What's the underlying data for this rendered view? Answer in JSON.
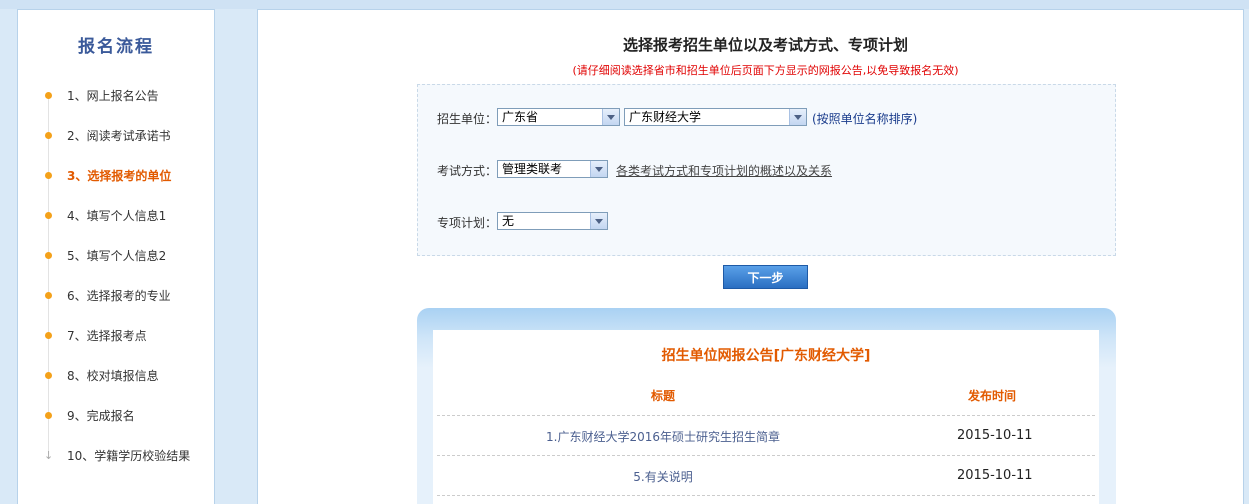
{
  "sidebar": {
    "title": "报名流程",
    "steps": [
      {
        "label": "1、网上报名公告"
      },
      {
        "label": "2、阅读考试承诺书"
      },
      {
        "label": "3、选择报考的单位"
      },
      {
        "label": "4、填写个人信息1"
      },
      {
        "label": "5、填写个人信息2"
      },
      {
        "label": "6、选择报考的专业"
      },
      {
        "label": "7、选择报考点"
      },
      {
        "label": "8、校对填报信息"
      },
      {
        "label": "9、完成报名"
      },
      {
        "label": "10、学籍学历校验结果"
      }
    ],
    "active_step": 3
  },
  "main": {
    "title": "选择报考招生单位以及考试方式、专项计划",
    "warning": "(请仔细阅读选择省市和招生单位后页面下方显示的网报公告,以免导致报名无效)",
    "form": {
      "unit_label": "招生单位：",
      "province_value": "广东省",
      "unit_value": "广东财经大学",
      "sort_link": "(按照单位名称排序)",
      "exam_label": "考试方式：",
      "exam_value": "管理类联考",
      "exam_desc_link": "各类考试方式和专项计划的概述以及关系",
      "plan_label": "专项计划：",
      "plan_value": "无"
    },
    "next_button": "下一步",
    "notice": {
      "title": "招生单位网报公告[广东财经大学]",
      "col_title": "标题",
      "col_date": "发布时间",
      "rows": [
        {
          "title": "1.广东财经大学2016年硕士研究生招生简章",
          "date": "2015-10-11"
        },
        {
          "title": "5.有关说明",
          "date": "2015-10-11"
        }
      ]
    }
  },
  "colors": {
    "accent": "#e25a00",
    "warning": "#e00000",
    "dot": "#f4a11a",
    "button": "#2a6fc2"
  }
}
